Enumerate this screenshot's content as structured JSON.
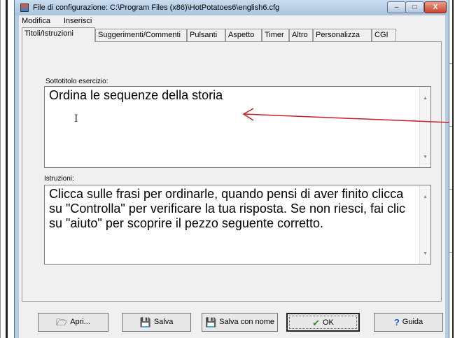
{
  "window": {
    "title": "File di configurazione: C:\\Program Files (x86)\\HotPotatoes6\\english6.cfg",
    "controls": {
      "minimize": "–",
      "maximize": "□",
      "close": "X"
    }
  },
  "menu": {
    "items": [
      "Modifica",
      "Inserisci"
    ]
  },
  "tabs": [
    "Titoli/Istruzioni",
    "Suggerimenti/Commenti",
    "Pulsanti",
    "Aspetto",
    "Timer",
    "Altro",
    "Personalizza",
    "CGI"
  ],
  "fields": {
    "subtitle": {
      "label": "Sottotitolo esercizio:",
      "value": "Ordina le sequenze della storia"
    },
    "instructions": {
      "label": "Istruzioni:",
      "value": "Clicca sulle frasi per ordinarle, quando pensi di aver finito clicca su  \"Controlla\" per verificare la tua risposta. Se non riesci, fai clic su \"aiuto\" per scoprire il  pezzo seguente corretto."
    }
  },
  "buttons": {
    "open": "Apri...",
    "save": "Salva",
    "save_as": "Salva con nome",
    "ok": "OK",
    "help": "Guida"
  },
  "icons": {
    "open": "folder-open-icon",
    "save": "floppy-disk-icon",
    "save_as": "floppy-disk-icon",
    "ok": "checkmark-icon",
    "help": "question-mark-icon"
  },
  "colors": {
    "arrow": "#c0202a",
    "ok_check": "#2a8a2a",
    "help_mark": "#1a5fc8"
  }
}
